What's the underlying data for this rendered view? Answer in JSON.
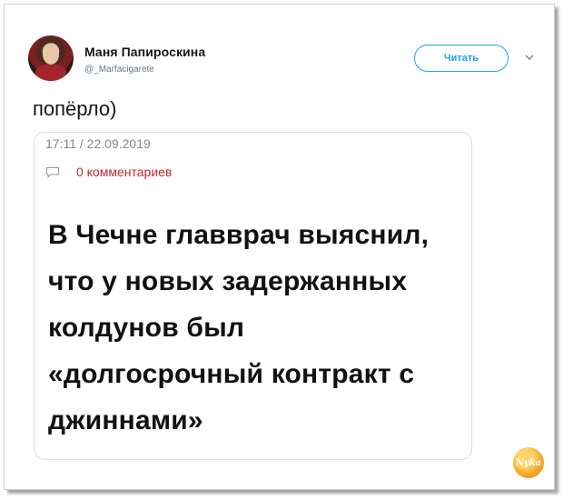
{
  "tweet": {
    "author_name": "Маня Папироскина",
    "author_handle": "@_Marfacigarete",
    "follow_label": "Читать",
    "text": "попёрло)"
  },
  "card": {
    "time_date": "17:11 / 22.09.2019",
    "comments": "0 комментариев",
    "headline": "В Чечне главврач выяснил, что у новых задержанных колдунов был «долгосрочный контракт с джиннами»"
  },
  "watermark": {
    "text": "Nyka"
  },
  "colors": {
    "accent": "#1da1f2",
    "comment_red": "#c0282d"
  }
}
